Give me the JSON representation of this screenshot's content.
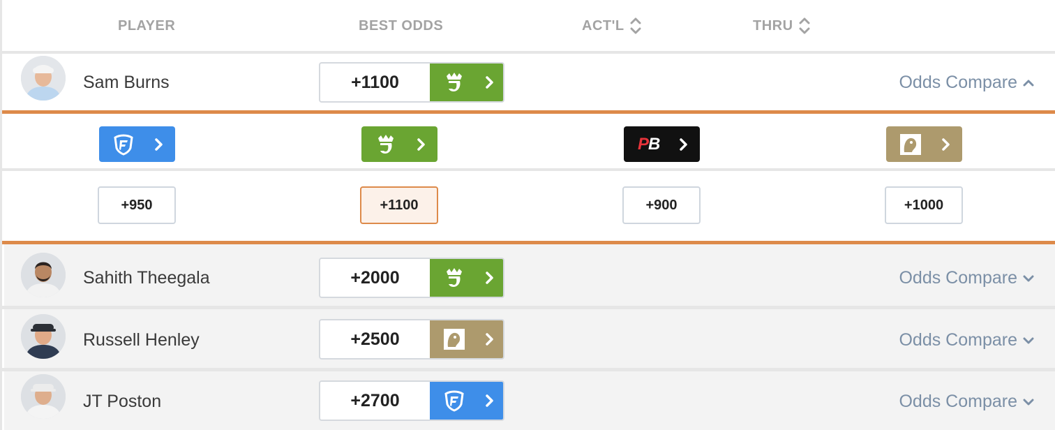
{
  "header": {
    "player": "PLAYER",
    "best_odds": "BEST ODDS",
    "actl": "ACT'L",
    "thru": "THRU"
  },
  "colors": {
    "draftkings": "#6aa532",
    "fanduel": "#3e8ee9",
    "pointsbet": "#111111",
    "betmgm": "#ad9a6d",
    "accent_orange": "#dd8a4a",
    "compare_link": "#7b8fa6"
  },
  "rows": [
    {
      "name": "Sam Burns",
      "best_odds": "+1100",
      "book": "draftkings",
      "compare": "Odds Compare",
      "compare_icon": "chevron-up-icon"
    },
    {
      "name": "Sahith Theegala",
      "best_odds": "+2000",
      "book": "draftkings",
      "compare": "Odds Compare",
      "compare_icon": "chevron-down-icon"
    },
    {
      "name": "Russell Henley",
      "best_odds": "+2500",
      "book": "betmgm",
      "compare": "Odds Compare",
      "compare_icon": "chevron-down-icon"
    },
    {
      "name": "JT Poston",
      "best_odds": "+2700",
      "book": "fanduel",
      "compare": "Odds Compare",
      "compare_icon": "chevron-down-icon"
    }
  ],
  "expanded": {
    "books": [
      {
        "book": "fanduel",
        "odds": "+950",
        "best": false
      },
      {
        "book": "draftkings",
        "odds": "+1100",
        "best": true
      },
      {
        "book": "pointsbet",
        "odds": "+900",
        "best": false,
        "logo_text": "PB"
      },
      {
        "book": "betmgm",
        "odds": "+1000",
        "best": false
      }
    ]
  }
}
